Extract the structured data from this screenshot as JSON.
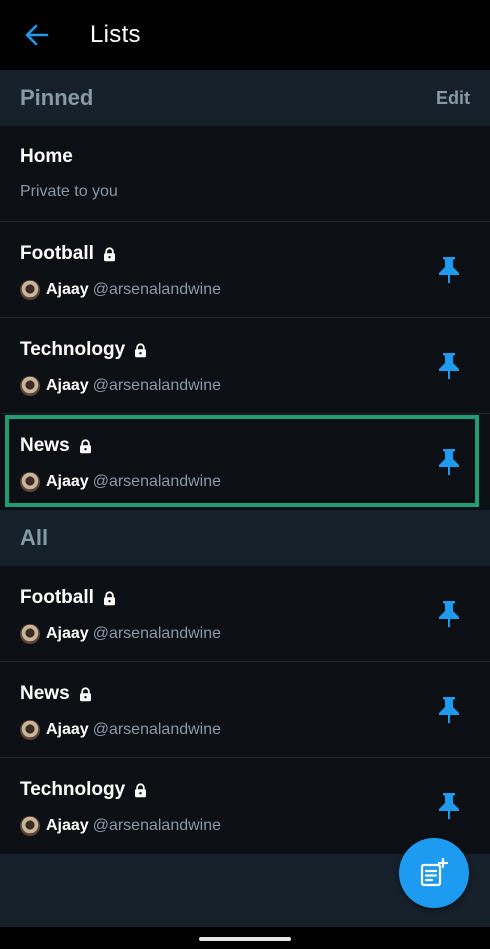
{
  "header": {
    "title": "Lists"
  },
  "pinned": {
    "title": "Pinned",
    "edit_label": "Edit",
    "items": [
      {
        "name": "Home",
        "subtitle": "Private to you"
      },
      {
        "name": "Football",
        "owner": "Ajaay",
        "handle": "@arsenalandwine"
      },
      {
        "name": "Technology",
        "owner": "Ajaay",
        "handle": "@arsenalandwine"
      },
      {
        "name": "News",
        "owner": "Ajaay",
        "handle": "@arsenalandwine"
      }
    ]
  },
  "all": {
    "title": "All",
    "items": [
      {
        "name": "Football",
        "owner": "Ajaay",
        "handle": "@arsenalandwine"
      },
      {
        "name": "News",
        "owner": "Ajaay",
        "handle": "@arsenalandwine"
      },
      {
        "name": "Technology",
        "owner": "Ajaay",
        "handle": "@arsenalandwine"
      }
    ]
  },
  "colors": {
    "accent": "#1d9bf0",
    "highlight_border": "#1f9e75",
    "background": "#15202b",
    "row_background": "#0c0f14",
    "muted_text": "#8899a6"
  },
  "icons": {
    "back": "arrow-left-icon",
    "lock": "lock-icon",
    "pin": "pin-icon",
    "fab": "new-list-icon"
  }
}
